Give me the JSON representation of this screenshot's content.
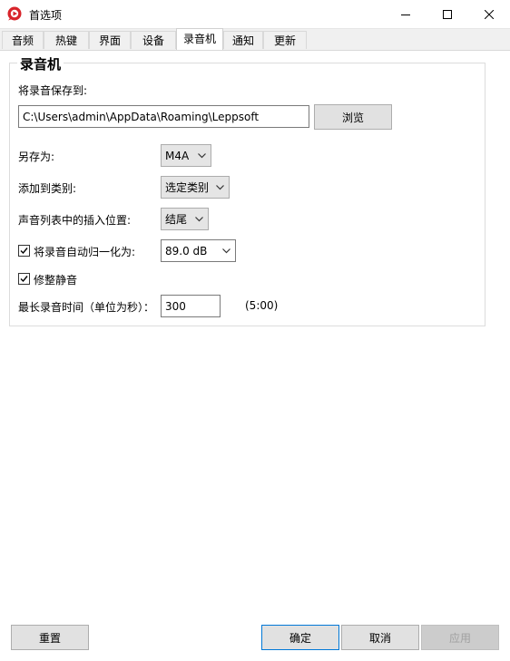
{
  "window": {
    "title": "首选项"
  },
  "tabs": [
    {
      "label": "音频"
    },
    {
      "label": "热键"
    },
    {
      "label": "界面"
    },
    {
      "label": "设备"
    },
    {
      "label": "录音机",
      "active": true
    },
    {
      "label": "通知"
    },
    {
      "label": "更新"
    }
  ],
  "recorder": {
    "group_title": "录音机",
    "save_path_label": "将录音保存到:",
    "save_path_value": "C:\\Users\\admin\\AppData\\Roaming\\Leppsoft",
    "browse_label": "浏览",
    "save_as_label": "另存为:",
    "save_as_value": "M4A",
    "category_label": "添加到类别:",
    "category_value": "选定类别",
    "insert_position_label": "声音列表中的插入位置:",
    "insert_position_value": "结尾",
    "normalize_label": "将录音自动归一化为:",
    "normalize_checked": true,
    "normalize_value": "89.0 dB",
    "trim_silence_label": "修整静音",
    "trim_silence_checked": true,
    "max_time_label": "最长录音时间（单位为秒）：",
    "max_time_value": "300",
    "max_time_display": "(5:00)"
  },
  "buttons": {
    "reset": "重置",
    "ok": "确定",
    "cancel": "取消",
    "apply": "应用"
  },
  "colors": {
    "app_icon": "#d8232a",
    "focus_border": "#0078d7"
  }
}
